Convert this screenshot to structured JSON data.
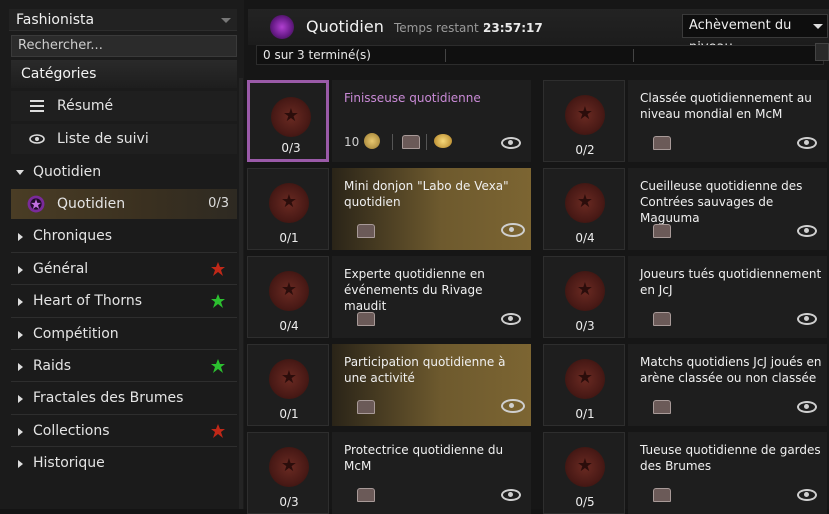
{
  "sidebar": {
    "character": "Fashionista",
    "search_placeholder": "Rechercher...",
    "categories_title": "Catégories",
    "items": [
      {
        "label": "Résumé",
        "icon": "list-icon"
      },
      {
        "label": "Liste de suivi",
        "icon": "eye-icon"
      },
      {
        "label": "Quotidien",
        "expanded": true
      },
      {
        "label": "Quotidien",
        "count": "0/3",
        "selected": true
      },
      {
        "label": "Chroniques"
      },
      {
        "label": "Général",
        "badge": "red"
      },
      {
        "label": "Heart of Thorns",
        "badge": "green"
      },
      {
        "label": "Compétition"
      },
      {
        "label": "Raids",
        "badge": "green"
      },
      {
        "label": "Fractales des Brumes"
      },
      {
        "label": "Collections",
        "badge": "red"
      },
      {
        "label": "Historique"
      }
    ]
  },
  "header": {
    "title": "Quotidien",
    "timer_label": "Temps restant :",
    "timer_value": "23:57:17",
    "sort_label": "Achèvement du niveau",
    "progress_text": "0 sur 3 terminé(s)",
    "progress_value": 0
  },
  "achievements": [
    {
      "name": "Finisseuse quotidienne",
      "count": "0/3",
      "focused": true,
      "rewards": {
        "count": "10"
      }
    },
    {
      "name": "Classée quotidiennement au niveau mondial en McM",
      "count": "0/2"
    },
    {
      "name": "Mini donjon \"Labo de Vexa\" quotidien",
      "count": "0/1",
      "gold": true
    },
    {
      "name": "Cueilleuse quotidienne des Contrées sauvages de Maguuma",
      "count": "0/4"
    },
    {
      "name": "Experte quotidienne en événements du Rivage maudit",
      "count": "0/4"
    },
    {
      "name": "Joueurs tués quotidiennement en JcJ",
      "count": "0/3"
    },
    {
      "name": "Participation quotidienne à une activité",
      "count": "0/1",
      "gold": true
    },
    {
      "name": "Matchs quotidiens JcJ joués en arène classée ou non classée",
      "count": "0/1"
    },
    {
      "name": "Protectrice quotidienne du McM",
      "count": "0/3"
    },
    {
      "name": "Tueuse quotidienne de gardes des Brumes",
      "count": "0/5"
    }
  ]
}
